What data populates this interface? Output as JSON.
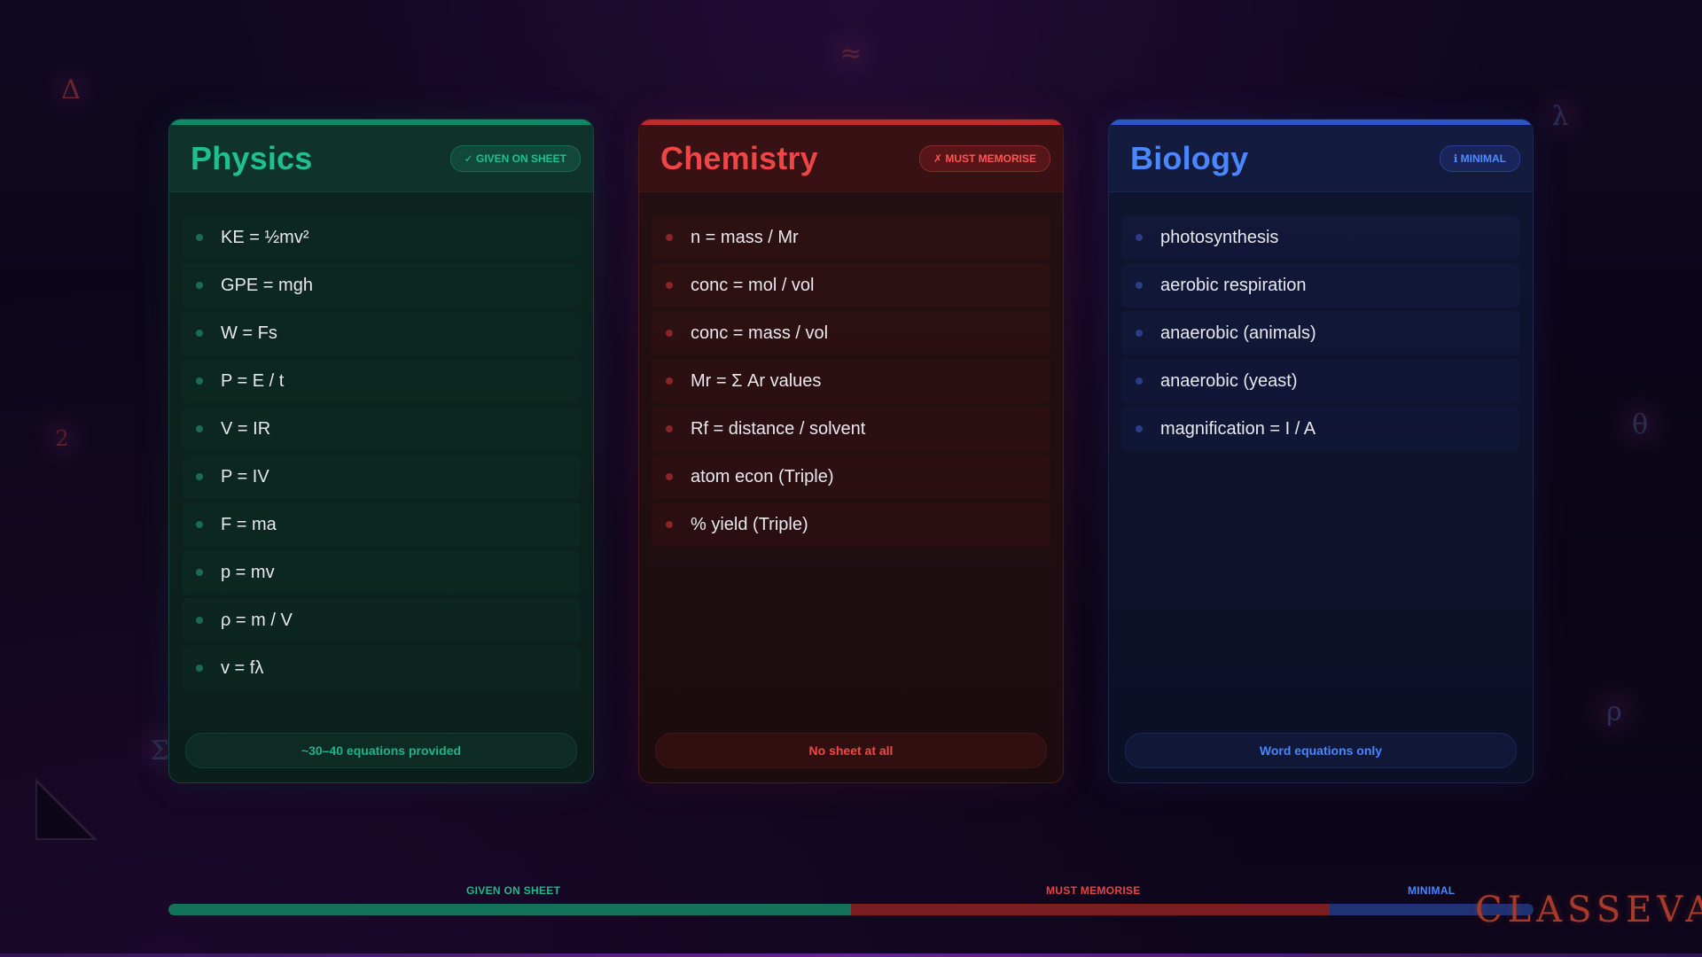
{
  "background_symbols": [
    {
      "glyph": "Δ",
      "color": "#6b2430"
    },
    {
      "glyph": "≈",
      "color": "#5a2236"
    },
    {
      "glyph": "λ",
      "color": "#2a2f55"
    },
    {
      "glyph": "2",
      "color": "#5c1f28"
    },
    {
      "glyph": "θ",
      "color": "#2d2f50"
    },
    {
      "glyph": "Σ",
      "color": "#2c2a4e"
    },
    {
      "glyph": "ρ",
      "color": "#2a2f55"
    }
  ],
  "cards": [
    {
      "title": "Physics",
      "badge": "✓ GIVEN ON SHEET",
      "accent": "#1fc08e",
      "items": [
        "KE = ½mv²",
        "GPE = mgh",
        "W = Fs",
        "P = E / t",
        "V = IR",
        "P = IV",
        "F = ma",
        "p = mv",
        "ρ = m / V",
        "v = fλ"
      ],
      "footer": "~30–40 equations provided"
    },
    {
      "title": "Chemistry",
      "badge": "✗ MUST MEMORISE",
      "accent": "#f04545",
      "items": [
        "n = mass / Mr",
        "conc = mol / vol",
        "conc = mass / vol",
        "Mr = Σ Ar values",
        "Rf = distance / solvent",
        "atom econ (Triple)",
        "% yield (Triple)"
      ],
      "footer": "No sheet at all"
    },
    {
      "title": "Biology",
      "badge": "ℹ MINIMAL",
      "accent": "#4a86ff",
      "items": [
        "photosynthesis",
        "aerobic respiration",
        "anaerobic (animals)",
        "anaerobic (yeast)",
        "magnification = I / A"
      ],
      "footer": "Word equations only"
    }
  ],
  "legend": {
    "given_label": "GIVEN ON SHEET",
    "memorise_label": "MUST MEMORISE",
    "minimal_label": "MINIMAL",
    "colors": {
      "given": "#1fb98a",
      "memorise": "#e94444",
      "minimal": "#4a86ff"
    }
  },
  "brand": {
    "name": "CLASSEVA"
  }
}
